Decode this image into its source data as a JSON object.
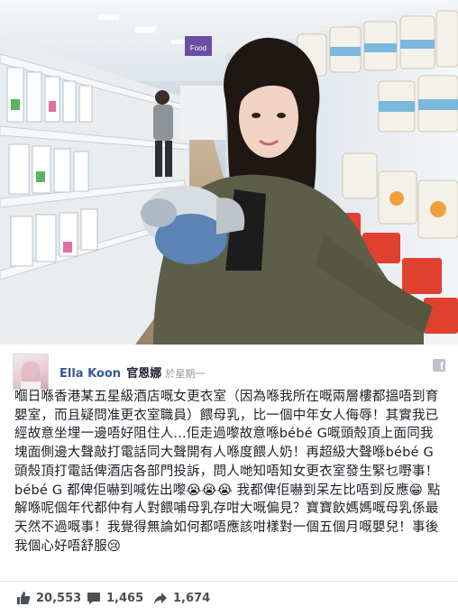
{
  "post": {
    "author_name": "Ella Koon",
    "author_cn": "官恩娜",
    "time": "於星期一",
    "text": "嗰日喺香港某五星級酒店嘅女更衣室（因為喺我所在嘅兩層樓都搵唔到育嬰室，而且疑問准更衣室職員）餵母乳，比一個中年女人侮辱！其實我已經故意坐埋一邊唔好阻住人...佢走過嚟故意喺bébé G嘅頭殼頂上面同我塊面側邊大聲敲打電話同大聲開有人喺度餵人奶！再超級大聲喺bébé G頭殼頂打電話俾酒店各部門投訴，問人哋知唔知女更衣室發生緊乜嘢事！bébé G 都俾佢嚇到喊佐出嚟😭😭😭 我都俾佢嚇到呆左比唔到反應😁 點解喺呢個年代都仲有人對餵哺母乳存咁大嘅偏見？寶寶飲媽媽嘅母乳係最天然不過嘅事！我覺得無論如何都唔應該咁樣對一個五個月嘅嬰兒！事後我個心好唔舒服😢",
    "likes": "20,553",
    "comments": "1,465",
    "shares": "1,674"
  },
  "photo": {
    "sign_text": "Food",
    "colors": {
      "jacket": "#5d5e48",
      "hair": "#1f1714",
      "skin": "#f1d3c3",
      "shelf": "#ecf0f3",
      "cans": "#f4f1ea"
    }
  },
  "icons": {
    "like": "thumbs-up-icon",
    "comment": "comment-icon",
    "share": "share-arrow-icon",
    "facebook": "facebook-icon"
  }
}
